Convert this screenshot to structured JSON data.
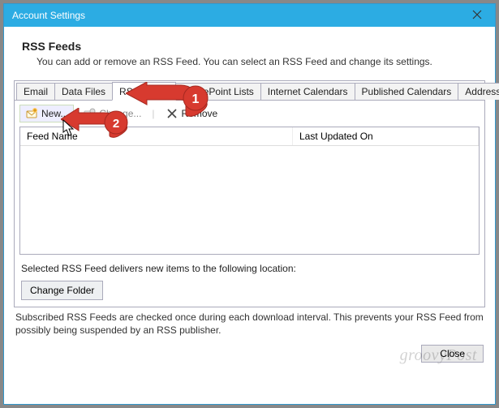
{
  "window": {
    "title": "Account Settings"
  },
  "header": {
    "title": "RSS Feeds",
    "subtitle": "You can add or remove an RSS Feed. You can select an RSS Feed and change its settings."
  },
  "tabs": [
    "Email",
    "Data Files",
    "RSS Feeds",
    "SharePoint Lists",
    "Internet Calendars",
    "Published Calendars",
    "Address Books"
  ],
  "active_tab_index": 2,
  "toolbar": {
    "new_label": "New...",
    "change_label": "Change...",
    "remove_label": "Remove"
  },
  "list": {
    "col_feed": "Feed Name",
    "col_updated": "Last Updated On"
  },
  "delivery_text": "Selected RSS Feed delivers new items to the following location:",
  "change_folder_label": "Change Folder",
  "footnote": "Subscribed RSS Feeds are checked once during each download interval. This prevents your RSS Feed from possibly being suspended by an RSS publisher.",
  "close_label": "Close",
  "watermark": "groovyPost",
  "callouts": {
    "one": "1",
    "two": "2"
  }
}
